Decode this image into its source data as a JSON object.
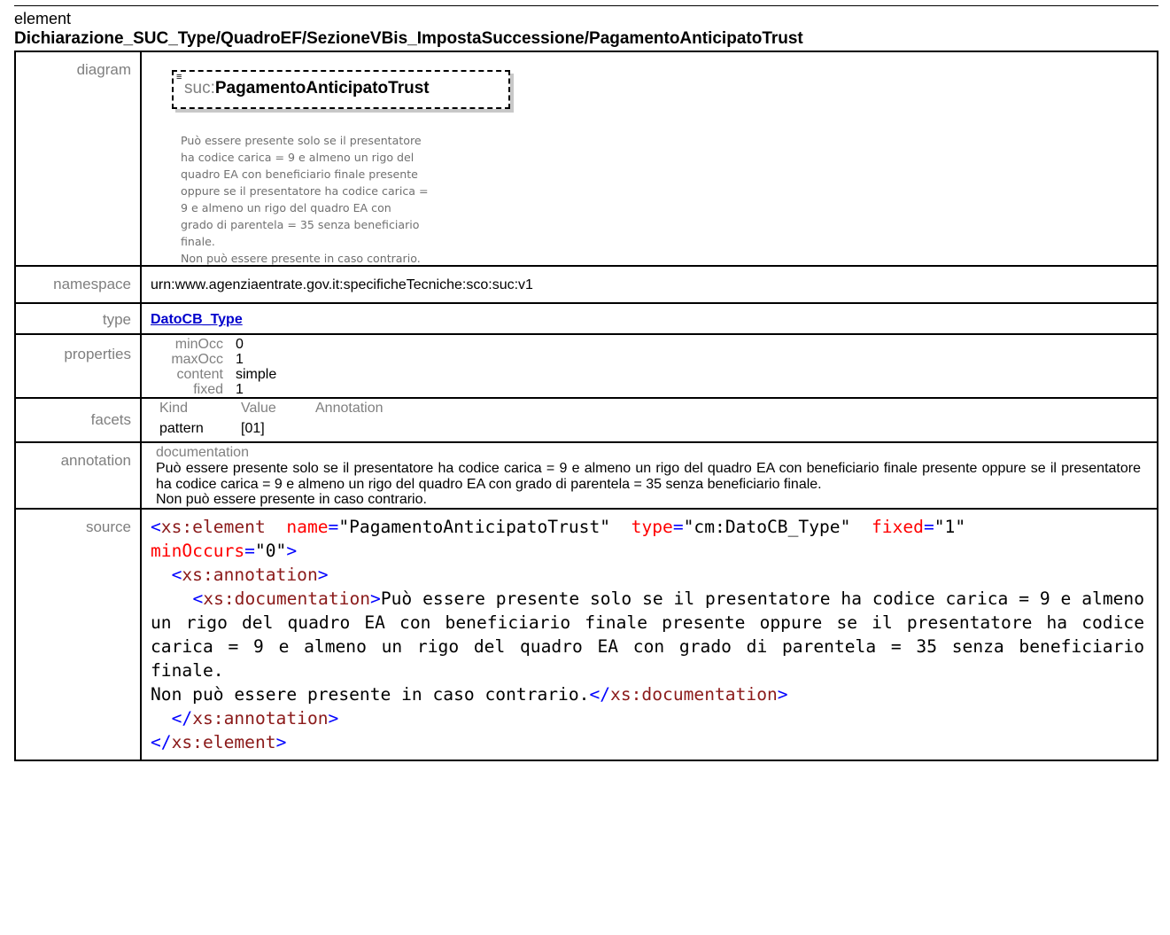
{
  "header": {
    "kind": "element",
    "path": "Dichiarazione_SUC_Type/QuadroEF/SezioneVBis_ImpostaSuccessione/PagamentoAnticipatoTrust"
  },
  "labels": {
    "diagram": "diagram",
    "namespace": "namespace",
    "type": "type",
    "properties": "properties",
    "facets": "facets",
    "annotation": "annotation",
    "source": "source"
  },
  "diagram": {
    "prefix": "suc:",
    "name": "PagamentoAnticipatoTrust",
    "note_lines": [
      "Può essere presente solo se il presentatore",
      "ha codice carica = 9 e almeno un rigo del",
      "quadro EA con beneficiario finale presente",
      "oppure se il presentatore ha codice carica =",
      "9 e almeno un rigo del quadro EA con",
      "grado di parentela = 35 senza beneficiario",
      "finale.",
      "Non può essere presente in caso contrario."
    ]
  },
  "namespace": "urn:www.agenziaentrate.gov.it:specificheTecniche:sco:suc:v1",
  "type": "DatoCB_Type",
  "properties": [
    {
      "key": "minOcc",
      "value": "0"
    },
    {
      "key": "maxOcc",
      "value": "1"
    },
    {
      "key": "content",
      "value": "simple"
    },
    {
      "key": "fixed",
      "value": "1"
    }
  ],
  "facets": {
    "headers": [
      "Kind",
      "Value",
      "Annotation"
    ],
    "rows": [
      {
        "kind": "pattern",
        "value": "[01]",
        "annotation": ""
      }
    ]
  },
  "annotation": {
    "heading": "documentation",
    "text": "Può essere presente solo se il presentatore ha codice carica = 9 e almeno un rigo del quadro EA con beneficiario finale presente oppure se il presentatore ha codice carica = 9 e almeno un rigo del quadro EA con grado di parentela = 35 senza beneficiario finale.",
    "text2": "Non può essere presente in caso contrario."
  },
  "source": {
    "l1_open": "<",
    "l1_tag": "xs:element",
    "a_name": "name",
    "v_name": "\"PagamentoAnticipatoTrust\"",
    "a_type": "type",
    "v_type": "\"cm:DatoCB_Type\"",
    "a_fixed": "fixed",
    "v_fixed": "\"1\"",
    "a_min": "minOccurs",
    "v_min": "\"0\"",
    "l1_close": ">",
    "annotation_tag": "xs:annotation",
    "documentation_tag": "xs:documentation",
    "doc_text": "Può essere presente solo se il presentatore ha codice carica = 9 e almeno un rigo del quadro EA con beneficiario finale presente oppure se il presentatore ha codice carica = 9 e almeno un rigo del quadro EA con grado di parentela = 35 senza beneficiario finale.",
    "doc_text2": "Non può essere presente in caso contrario.",
    "eq": "=",
    "lt": "<",
    "lt_slash": "</",
    "gt": ">"
  }
}
